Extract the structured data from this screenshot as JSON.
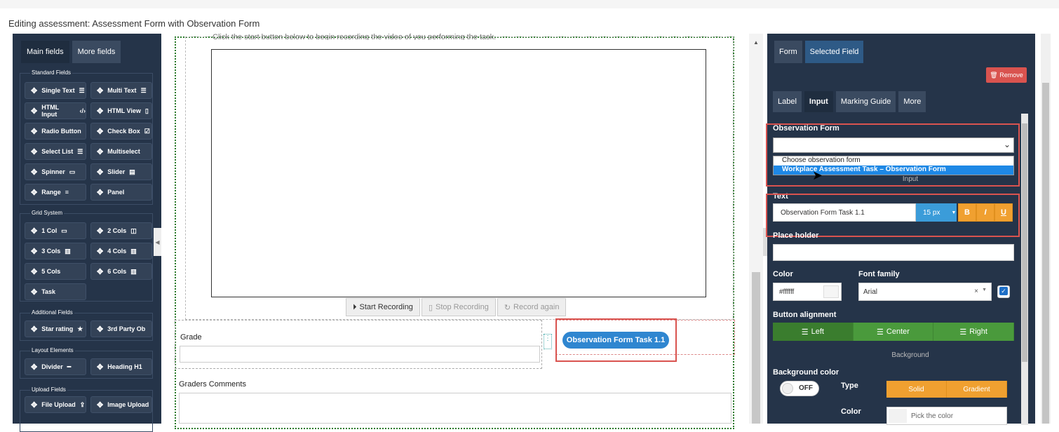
{
  "page": {
    "title": "Editing assessment: Assessment Form with Observation Form"
  },
  "left_panel": {
    "tabs": [
      "Main fields",
      "More fields"
    ],
    "standard_fields": {
      "title": "Standard Fields",
      "items": [
        "Single Text",
        "Multi Text",
        "HTML Input",
        "HTML View",
        "Radio Button",
        "Check Box",
        "Select List",
        "Multiselect",
        "Spinner",
        "Slider",
        "Range",
        "Panel"
      ]
    },
    "grid_system": {
      "title": "Grid System",
      "items": [
        "1 Col",
        "2 Cols",
        "3 Cols",
        "4 Cols",
        "5 Cols",
        "6 Cols",
        "Task"
      ]
    },
    "additional_fields": {
      "title": "Additional Fields",
      "items": [
        "Star rating",
        "3rd Party Ob"
      ]
    },
    "layout_elements": {
      "title": "Layout Elements",
      "items": [
        "Divider",
        "Heading H1"
      ]
    },
    "upload_fields": {
      "title": "Upload Fields",
      "items": [
        "File Upload",
        "Image Upload"
      ]
    }
  },
  "canvas": {
    "instruction": "Click the start button below to begin recording the video of you performing the task.",
    "recording": {
      "start": "Start Recording",
      "stop": "Stop Recording",
      "again": "Record again"
    },
    "grade_label": "Grade",
    "observation_button": "Observation Form Task 1.1",
    "comments_label": "Graders Comments"
  },
  "right_panel": {
    "tabs": [
      "Form",
      "Selected Field"
    ],
    "remove_label": "Remove",
    "subtabs": [
      "Label",
      "Input",
      "Marking Guide",
      "More"
    ],
    "observation_form_label": "Observation Form",
    "dropdown_options": [
      "Choose observation form",
      "Workplace Assessment Task – Observation Form"
    ],
    "input_divider": "Input",
    "text_label": "Text",
    "text_value": "Observation Form Task 1.1",
    "font_size": "15 px",
    "format": {
      "bold": "B",
      "italic": "I",
      "underline": "U"
    },
    "placeholder_label": "Place holder",
    "color_label": "Color",
    "color_value": "#ffffff",
    "font_family_label": "Font family",
    "font_family_value": "Arial",
    "button_alignment_label": "Button alignment",
    "alignment": [
      "Left",
      "Center",
      "Right"
    ],
    "background_divider": "Background",
    "background_color_label": "Background color",
    "toggle_state": "OFF",
    "type_label": "Type",
    "types": [
      "Solid",
      "Gradient"
    ],
    "color_label2": "Color",
    "pick_color_placeholder": "Pick the color"
  },
  "colors": {
    "panel": "#253449",
    "accent_blue": "#2f86d0",
    "green": "#4a9a3c",
    "orange": "#f0a030",
    "red": "#d9534f"
  }
}
